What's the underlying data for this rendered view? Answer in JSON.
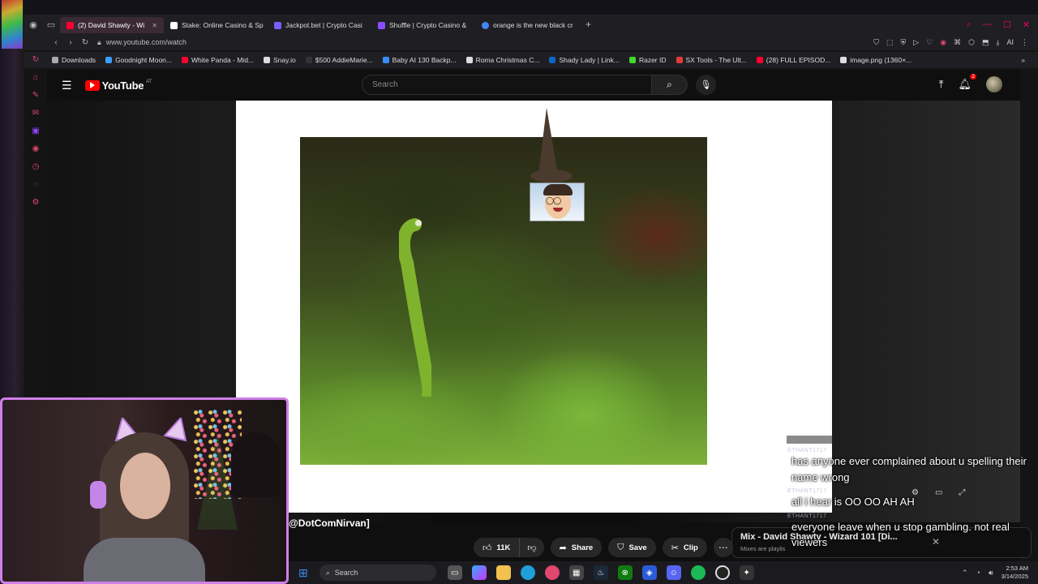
{
  "browser": {
    "tabs": [
      {
        "label": "(2) David Shawty - Wi",
        "active": true,
        "color": "#ff0033"
      },
      {
        "label": "Stake: Online Casino & Sp",
        "active": false,
        "color": "#ffffff"
      },
      {
        "label": "Jackpot.bet | Crypto Casi",
        "active": false,
        "color": "#7a5cff"
      },
      {
        "label": "Shuffle | Crypto Casino &",
        "active": false,
        "color": "#8a4dff"
      },
      {
        "label": "orange is the new black cr",
        "active": false,
        "color": "#4285f4"
      }
    ],
    "url": "www.youtube.com/watch",
    "bookmarks": [
      {
        "label": "Downloads",
        "color": "#aaaaaa"
      },
      {
        "label": "Goodnight Moon...",
        "color": "#3aa0ff"
      },
      {
        "label": "White Panda - Mid...",
        "color": "#ff0033"
      },
      {
        "label": "Snay.io",
        "color": "#dddddd"
      },
      {
        "label": "$500 AddieMarie...",
        "color": "#333333"
      },
      {
        "label": "Baby AI 130 Backp...",
        "color": "#3a8dff"
      },
      {
        "label": "Roma Christmas C...",
        "color": "#dddddd"
      },
      {
        "label": "Shady Lady | Link...",
        "color": "#0a66c2"
      },
      {
        "label": "Razer ID",
        "color": "#44d62c"
      },
      {
        "label": "SX Tools - The Ult...",
        "color": "#e03a3a"
      },
      {
        "label": "(28) FULL EPISOD...",
        "color": "#ff0033"
      },
      {
        "label": "image.png (1360×...",
        "color": "#dddddd"
      }
    ]
  },
  "youtube": {
    "logo": "YouTube",
    "country": "AT",
    "search_placeholder": "Search",
    "notification_count": "2",
    "channel_handle": "@DotComNirvan]",
    "like_count": "11K",
    "share_label": "Share",
    "save_label": "Save",
    "clip_label": "Clip",
    "mix_title": "Mix - David Shawty - Wizard 101 [Di...",
    "mix_subtitle": "Mixes are playlis"
  },
  "chat": [
    {
      "user": "ETHANT1717",
      "text": "has anyone ever complained about u spelling their name wrong"
    },
    {
      "user": "ETHANT1717",
      "text": "all i hear is OO OO AH AH"
    },
    {
      "user": "ETHANT1717",
      "text": "everyone leave when u stop gambling. not real viewers"
    }
  ],
  "taskbar": {
    "search_label": "Search",
    "time": "2:53 AM",
    "date": "3/14/2025"
  },
  "colors": {
    "accent_youtube": "#ff0000",
    "webcam_border": "#cf7fe8",
    "browser_accent": "#e0466e"
  }
}
